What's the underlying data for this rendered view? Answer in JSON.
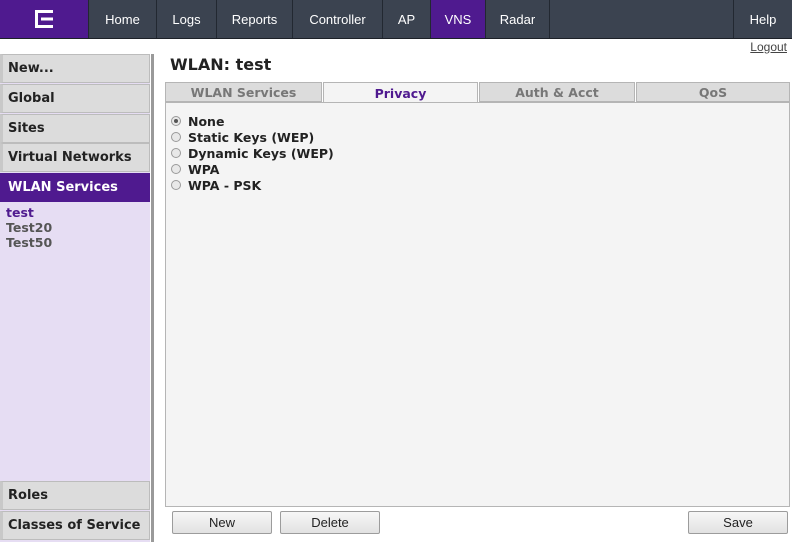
{
  "nav": {
    "items": [
      {
        "label": "Home",
        "active": false
      },
      {
        "label": "Logs",
        "active": false
      },
      {
        "label": "Reports",
        "active": false
      },
      {
        "label": "Controller",
        "active": false
      },
      {
        "label": "AP",
        "active": false
      },
      {
        "label": "VNS",
        "active": true
      },
      {
        "label": "Radar",
        "active": false
      }
    ],
    "help": "Help",
    "logout": "Logout"
  },
  "sidebar": {
    "items": [
      "New...",
      "Global",
      "Sites",
      "Virtual Networks",
      "WLAN Services"
    ],
    "active": "WLAN Services",
    "sub_items": [
      "test",
      "Test20",
      "Test50"
    ],
    "current_sub": "test",
    "bottom_items": [
      "Roles",
      "Classes of Service"
    ]
  },
  "main": {
    "title": "WLAN: test",
    "tabs": [
      {
        "label": "WLAN Services",
        "active": false
      },
      {
        "label": "Privacy",
        "active": true
      },
      {
        "label": "Auth & Acct",
        "active": false
      },
      {
        "label": "QoS",
        "active": false
      }
    ],
    "privacy_options": [
      {
        "label": "None",
        "selected": true
      },
      {
        "label": "Static Keys (WEP)",
        "selected": false
      },
      {
        "label": "Dynamic Keys (WEP)",
        "selected": false
      },
      {
        "label": "WPA",
        "selected": false
      },
      {
        "label": "WPA - PSK",
        "selected": false
      }
    ]
  },
  "buttons": {
    "new": "New",
    "delete": "Delete",
    "save": "Save"
  },
  "colors": {
    "brand_purple": "#4f1a8f",
    "nav_bg": "#3b4350",
    "sidebar_bg": "#e6ddf3"
  }
}
